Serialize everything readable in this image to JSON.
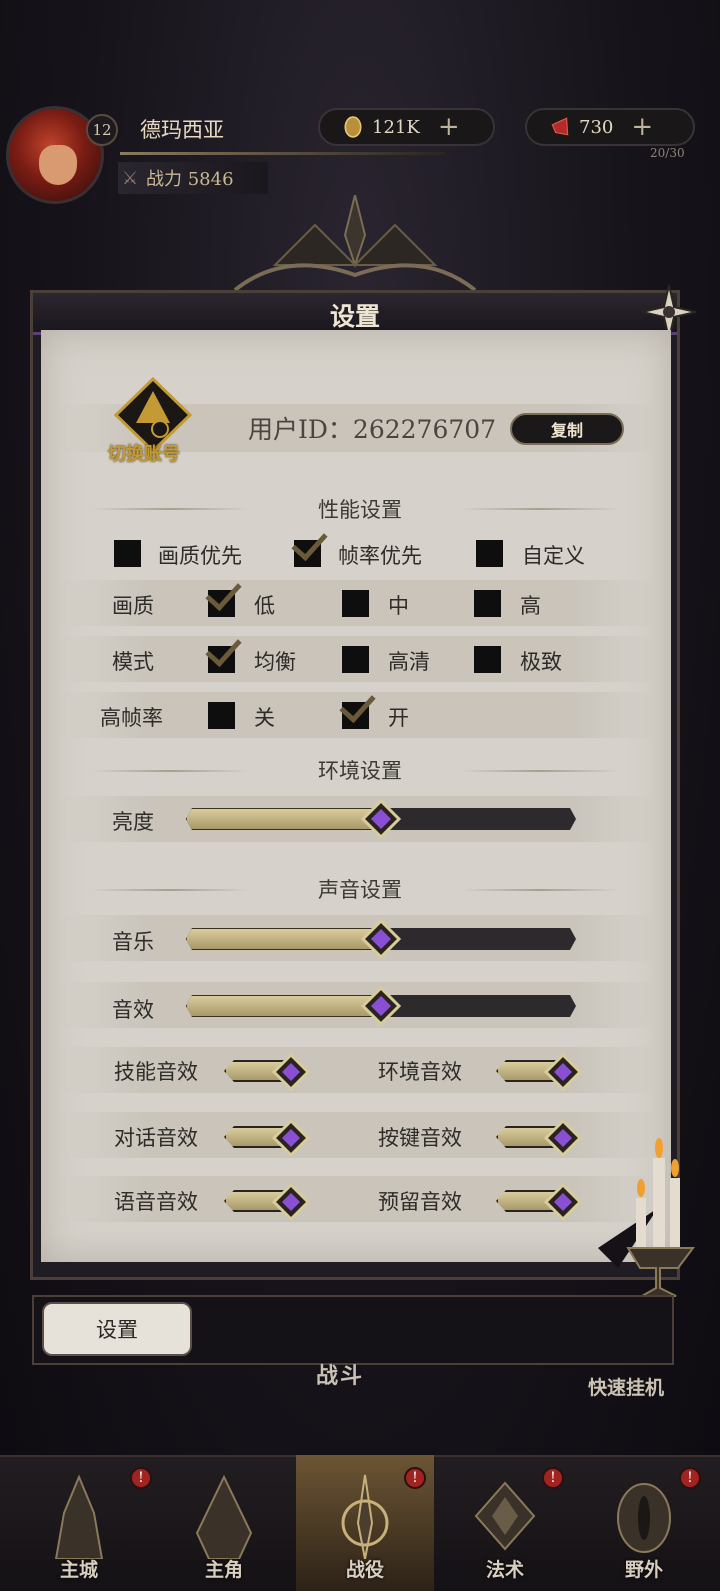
{
  "player": {
    "level": "12",
    "name": "德玛西亚",
    "power": "战力 5846"
  },
  "resources": {
    "gold": "121K",
    "gem": "730",
    "stamina": "20/30"
  },
  "panel": {
    "title": "设置",
    "switch_account": "切换账号",
    "user_id": "用户ID：262276707",
    "copy_button": "复制"
  },
  "performance": {
    "heading": "性能设置",
    "presets": [
      {
        "label": "画质优先",
        "checked": false
      },
      {
        "label": "帧率优先",
        "checked": true
      },
      {
        "label": "自定义",
        "checked": false
      }
    ],
    "quality": {
      "label": "画质",
      "options": [
        {
          "label": "低",
          "checked": true
        },
        {
          "label": "中",
          "checked": false
        },
        {
          "label": "高",
          "checked": false
        }
      ]
    },
    "mode": {
      "label": "模式",
      "options": [
        {
          "label": "均衡",
          "checked": true
        },
        {
          "label": "高清",
          "checked": false
        },
        {
          "label": "极致",
          "checked": false
        }
      ]
    },
    "high_fps": {
      "label": "高帧率",
      "options": [
        {
          "label": "关",
          "checked": false
        },
        {
          "label": "开",
          "checked": true
        }
      ]
    }
  },
  "environment": {
    "heading": "环境设置",
    "brightness": {
      "label": "亮度",
      "level": 0.5
    }
  },
  "sound": {
    "heading": "声音设置",
    "music": {
      "label": "音乐",
      "level": 0.5
    },
    "effects": {
      "label": "音效",
      "level": 0.5
    },
    "toggles": [
      {
        "label": "技能音效",
        "on": true
      },
      {
        "label": "环境音效",
        "on": true
      },
      {
        "label": "对话音效",
        "on": true
      },
      {
        "label": "按键音效",
        "on": true
      },
      {
        "label": "语音音效",
        "on": true
      },
      {
        "label": "预留音效",
        "on": true
      }
    ]
  },
  "bottom": {
    "tab_label": "设置",
    "battle": "战斗",
    "quick_idle": "快速挂机"
  },
  "nav": [
    {
      "label": "主城",
      "alert": "!"
    },
    {
      "label": "主角",
      "alert": ""
    },
    {
      "label": "战役",
      "alert": "!"
    },
    {
      "label": "法术",
      "alert": "!"
    },
    {
      "label": "野外",
      "alert": "!"
    }
  ],
  "colors": {
    "accent_purple": "#5b3f7a",
    "gold": "#c39a33",
    "paper": "#d6d2cb"
  }
}
